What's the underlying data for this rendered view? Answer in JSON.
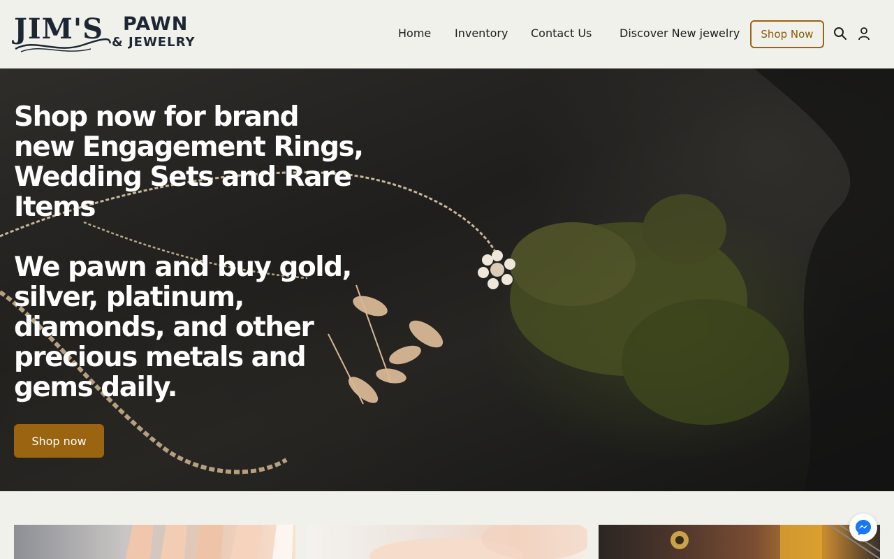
{
  "brand": {
    "logo_main": "JIM'S",
    "logo_pawn": "PAWN",
    "logo_jewelry": "& JEWELRY"
  },
  "nav": {
    "items": [
      {
        "label": "Home"
      },
      {
        "label": "Inventory"
      },
      {
        "label": "Contact Us"
      },
      {
        "label": "Discover New jewelry"
      }
    ],
    "shop_button": "Shop Now",
    "icons": [
      "search-icon",
      "account-icon"
    ]
  },
  "hero": {
    "headline_1": "Shop now for brand new Engagement Rings, Wedding Sets and Rare Items",
    "headline_2": "We pawn and buy gold, silver, platinum, diamonds, and other precious metals and gems daily.",
    "button": "Shop now"
  },
  "cards": [
    {
      "name": "rings-on-hand"
    },
    {
      "name": "ring-closeup"
    },
    {
      "name": "guitar-item"
    }
  ],
  "colors": {
    "accent": "#9a6410",
    "page_bg": "#f1f1ec",
    "text_dark": "#1d2733"
  },
  "chat": {
    "icon": "messenger-icon"
  }
}
